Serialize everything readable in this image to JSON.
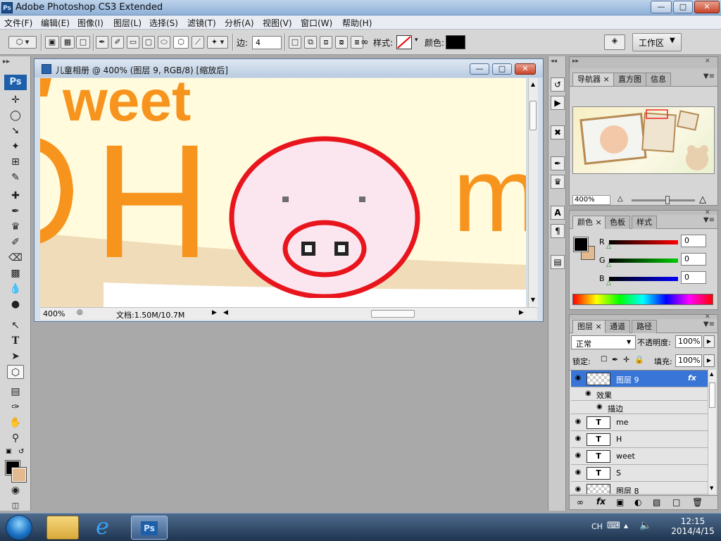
{
  "window": {
    "title": "Adobe Photoshop CS3 Extended",
    "logo": "Ps"
  },
  "menu": [
    "文件(F)",
    "编辑(E)",
    "图像(I)",
    "图层(L)",
    "选择(S)",
    "滤镜(T)",
    "分析(A)",
    "视图(V)",
    "窗口(W)",
    "帮助(H)"
  ],
  "options": {
    "sides_label": "边:",
    "sides_value": "4",
    "style_label": "样式:",
    "color_label": "颜色:",
    "workspace_label": "工作区",
    "fill_color": "#000000"
  },
  "toolbox": {
    "badge": "Ps",
    "fg_color": "#000000",
    "bg_color": "#e3b98f"
  },
  "document": {
    "title": "儿童相册 @ 400% (图层 9, RGB/8) [缩放后]",
    "zoom": "400%",
    "doc_info": "文档:1.50M/10.7M",
    "canvas_text": {
      "weet": "weet",
      "H": "H",
      "m": "m"
    }
  },
  "navigator": {
    "tabs": [
      "导航器",
      "直方图",
      "信息"
    ],
    "zoom": "400%"
  },
  "color_panel": {
    "tabs": [
      "颜色",
      "色板",
      "样式"
    ],
    "channels": [
      {
        "label": "R",
        "value": "0"
      },
      {
        "label": "G",
        "value": "0"
      },
      {
        "label": "B",
        "value": "0"
      }
    ]
  },
  "layers_panel": {
    "tabs": [
      "图层",
      "通道",
      "路径"
    ],
    "blend_mode": "正常",
    "opacity_label": "不透明度:",
    "opacity": "100%",
    "lock_label": "锁定:",
    "fill_label": "填充:",
    "fill": "100%",
    "effects_label": "效果",
    "stroke_label": "描边",
    "layers": [
      {
        "name": "图层 9",
        "type": "pixel"
      },
      {
        "name": "me",
        "type": "text"
      },
      {
        "name": "H",
        "type": "text"
      },
      {
        "name": "weet",
        "type": "text"
      },
      {
        "name": "S",
        "type": "text"
      },
      {
        "name": "图层 8",
        "type": "pixel"
      }
    ]
  },
  "taskbar": {
    "lang": "CH",
    "time": "12:15",
    "date": "2014/4/15"
  }
}
